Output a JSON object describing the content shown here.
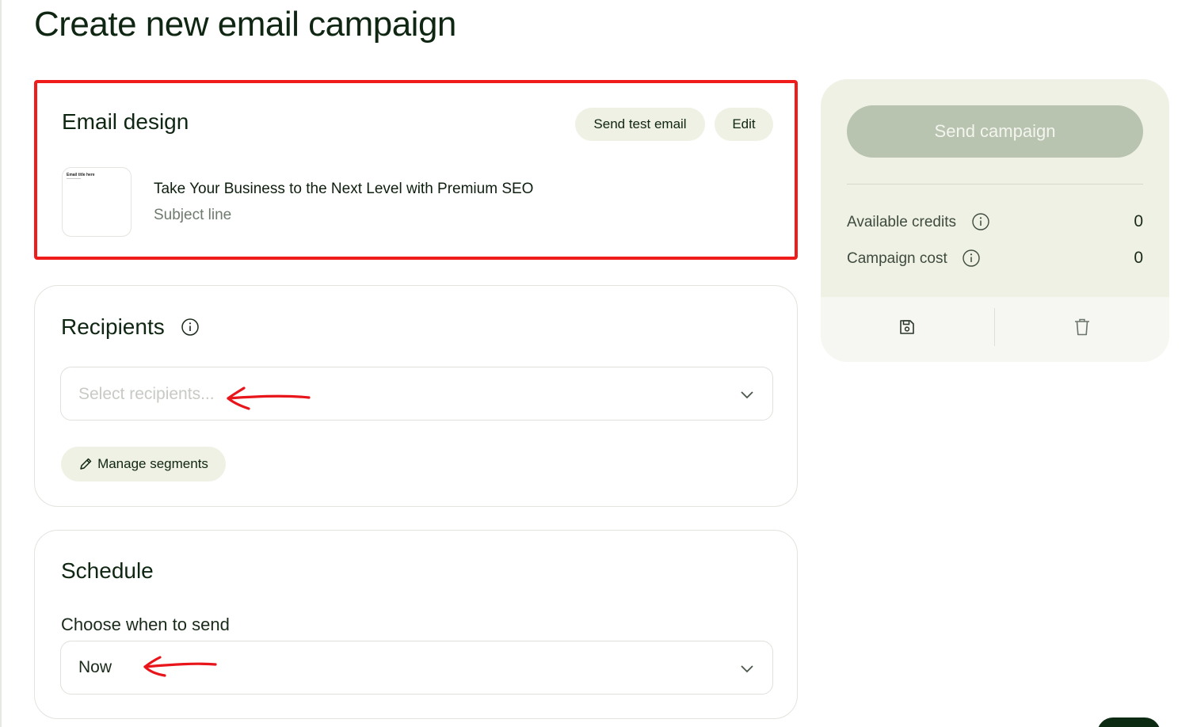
{
  "page": {
    "title": "Create new email campaign"
  },
  "email_design": {
    "title": "Email design",
    "send_test_label": "Send test email",
    "edit_label": "Edit",
    "thumbnail_heading": "Email title here",
    "subject": "Take Your Business to the Next Level with Premium SEO",
    "subject_label": "Subject line"
  },
  "recipients": {
    "title": "Recipients",
    "placeholder": "Select recipients...",
    "manage_segments_label": "Manage segments"
  },
  "schedule": {
    "title": "Schedule",
    "choose_label": "Choose when to send",
    "selected_value": "Now"
  },
  "side_panel": {
    "send_campaign_label": "Send campaign",
    "available_credits_label": "Available credits",
    "available_credits_value": "0",
    "campaign_cost_label": "Campaign cost",
    "campaign_cost_value": "0"
  },
  "icons": {
    "info": "info-icon",
    "chevron": "chevron-down-icon",
    "pencil": "pencil-icon",
    "save": "save-icon",
    "trash": "trash-icon"
  },
  "colors": {
    "accent_pill": "#eef1e4",
    "send_disabled": "#b8c3b0",
    "highlight_border": "#ef1c1c",
    "annotation_arrow": "#e8151b",
    "title_text": "#0f2612"
  }
}
